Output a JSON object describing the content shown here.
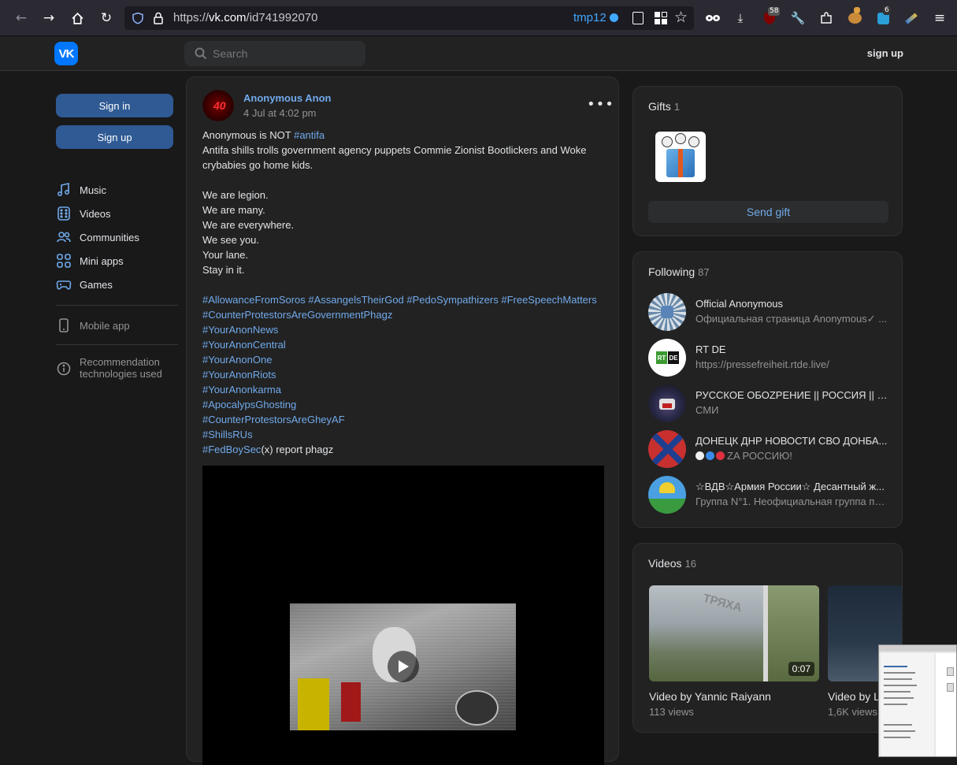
{
  "browser": {
    "url_prefix": "https://",
    "url_host": "vk.com",
    "url_path": "/id741992070",
    "container": "tmp12",
    "badge_ublock": "58",
    "badge_ext2": "6"
  },
  "header": {
    "logo": "VK",
    "search_placeholder": "Search",
    "signup": "sign up"
  },
  "left": {
    "signin": "Sign in",
    "signup": "Sign up",
    "nav": [
      {
        "label": "Music",
        "icon": "music-note-icon"
      },
      {
        "label": "Videos",
        "icon": "video-icon"
      },
      {
        "label": "Communities",
        "icon": "users-icon"
      },
      {
        "label": "Mini apps",
        "icon": "apps-grid-icon"
      },
      {
        "label": "Games",
        "icon": "gamepad-icon"
      }
    ],
    "mobile_app": "Mobile app",
    "recommendation_line1": "Recommendation",
    "recommendation_line2": "technologies used"
  },
  "post": {
    "avatar_text": "40",
    "author": "Anonymous Anon",
    "date": "4 Jul at 4:02 pm",
    "line1_text": "Anonymous is NOT ",
    "line1_tag": "#antifa",
    "line2": "Antifa shills trolls government agency puppets Commie Zionist Bootlickers and Woke",
    "line3": "crybabies go home kids.",
    "lines": [
      "We are legion.",
      "We are many.",
      "We are everywhere.",
      "We see you.",
      "Your lane.",
      "Stay in it."
    ],
    "tags_row": "#AllowanceFromSoros #AssangelsTheirGod #PedoSympathizers #FreeSpeechMatters",
    "tags": [
      "#CounterProtestorsAreGovernmentPhagz",
      "#YourAnonNews",
      "#YourAnonCentral",
      "#YourAnonOne",
      "#YourAnonRiots",
      "#YourAnonkarma",
      "#ApocalypsGhosting",
      "#CounterProtestorsAreGheyAF",
      "#ShillsRUs"
    ],
    "last_tag": "#FedBoySec",
    "last_text": "(x) report phagz"
  },
  "gifts": {
    "title": "Gifts",
    "count": "1",
    "send": "Send gift"
  },
  "following": {
    "title": "Following",
    "count": "87",
    "items": [
      {
        "name": "Official Anonymous",
        "sub": "Официальная страница Anonymous✓ ..."
      },
      {
        "name": "RT DE",
        "sub": "https://pressefreiheit.rtde.live/"
      },
      {
        "name": "РУССКОЕ ОБОZРЕНИЕ || РОССИЯ || П...",
        "sub": "СМИ"
      },
      {
        "name": "ДОНЕЦК ДНР НОВОСТИ СВО ДОНБА...",
        "sub": "ZA РОССИЮ!"
      },
      {
        "name": "☆ВДВ☆Армия России☆ Десантный ж...",
        "sub": "Группа N°1. Неофициальная группа по..."
      }
    ]
  },
  "videos": {
    "title": "Videos",
    "count": "16",
    "items": [
      {
        "title": "Video by Yannic Raiyann",
        "views": "113 views",
        "duration": "0:07",
        "watermark": "ТРЯХА"
      },
      {
        "title": "Video by L",
        "views": "1,6K views"
      }
    ]
  }
}
